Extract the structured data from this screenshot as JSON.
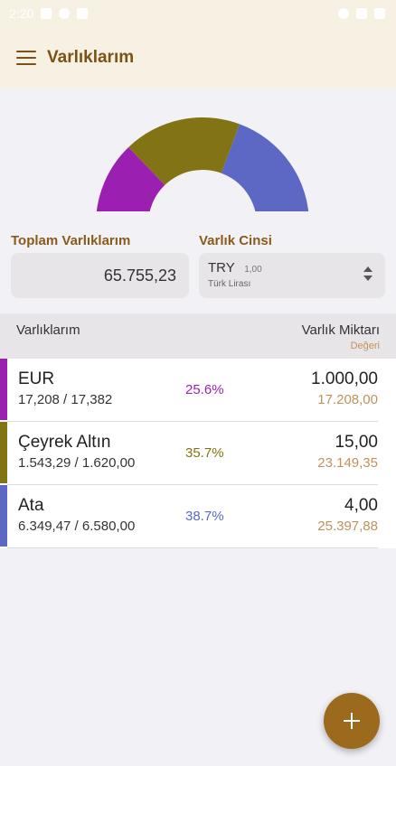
{
  "status_bar": {
    "time": "2:20"
  },
  "app_bar": {
    "title": "Varlıklarım"
  },
  "chart_data": {
    "type": "pie",
    "style": "half-donut",
    "categories": [
      "EUR",
      "Çeyrek Altın",
      "Ata"
    ],
    "values": [
      25.6,
      35.7,
      38.7
    ],
    "colors": [
      "#9b1fb1",
      "#827414",
      "#5c68c4"
    ]
  },
  "summary": {
    "total_label": "Toplam Varlıklarım",
    "total_value": "65.755,23",
    "type_label": "Varlık Cinsi",
    "currency_code": "TRY",
    "currency_rate": "1,00",
    "currency_name": "Türk Lirası"
  },
  "list": {
    "header_left": "Varlıklarım",
    "header_right": "Varlık Miktarı",
    "header_sub": "Değeri",
    "items": [
      {
        "name": "EUR",
        "rates": "17,208 / 17,382",
        "percent": "25.6%",
        "quantity": "1.000,00",
        "value": "17.208,00",
        "color": "#9b1fb1"
      },
      {
        "name": "Çeyrek Altın",
        "rates": "1.543,29 / 1.620,00",
        "percent": "35.7%",
        "quantity": "15,00",
        "value": "23.149,35",
        "color": "#827414"
      },
      {
        "name": "Ata",
        "rates": "6.349,47 / 6.580,00",
        "percent": "38.7%",
        "quantity": "4,00",
        "value": "25.397,88",
        "color": "#5c68c4"
      }
    ]
  },
  "fab": {
    "icon": "plus-icon"
  }
}
